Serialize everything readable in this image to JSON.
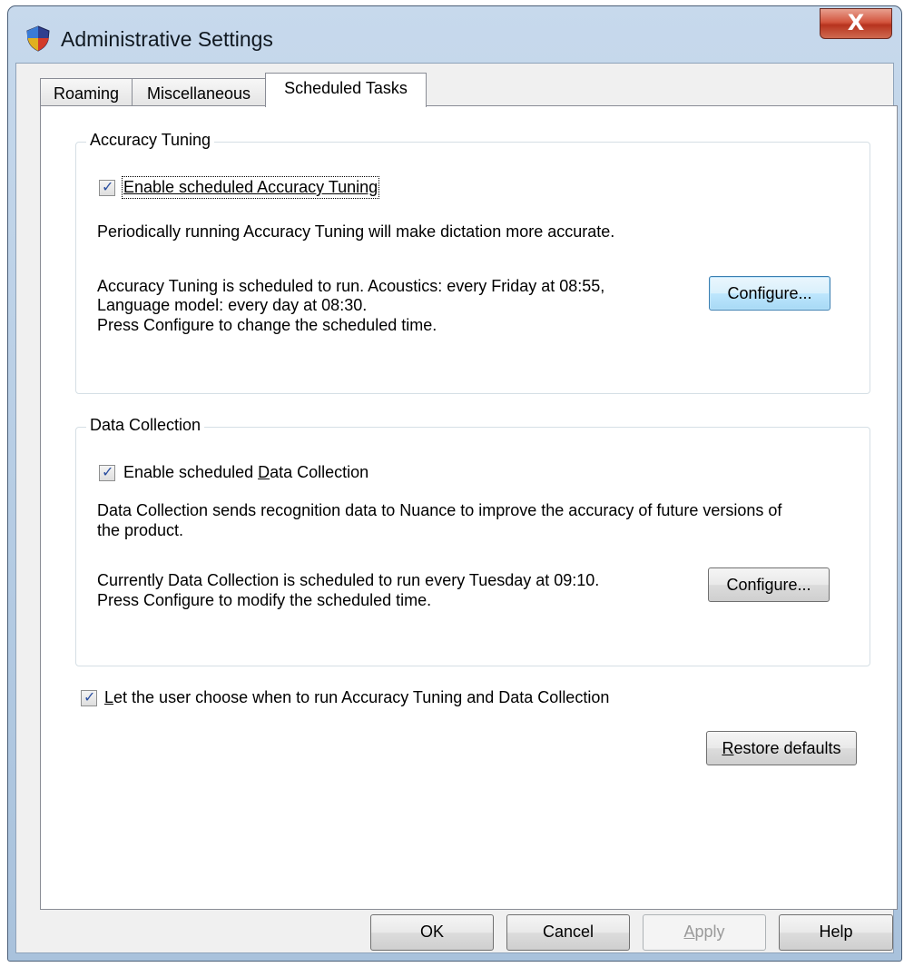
{
  "window": {
    "title": "Administrative Settings",
    "close_label": "X"
  },
  "tabs": [
    {
      "label": "Roaming"
    },
    {
      "label": "Miscellaneous"
    },
    {
      "label": "Scheduled Tasks",
      "active": true
    }
  ],
  "accuracy_tuning": {
    "group_title": "Accuracy Tuning",
    "enable_label_pre": "",
    "enable_label": "Enable scheduled Accuracy Tuning",
    "enabled": true,
    "description": "Periodically running Accuracy Tuning will make dictation more accurate.",
    "schedule_line1": "Accuracy Tuning is scheduled to run. Acoustics: every Friday at 08:55,",
    "schedule_line2": "Language model: every day at 08:30.",
    "schedule_line3": "Press Configure to change the scheduled time.",
    "configure_label": "Configure..."
  },
  "data_collection": {
    "group_title": "Data Collection",
    "enable_label_pre": "Enable scheduled ",
    "enable_label_accel": "D",
    "enable_label_post": "ata Collection",
    "enabled": true,
    "description_line1": "Data Collection sends recognition data to Nuance to improve the accuracy of future versions of",
    "description_line2": "the product.",
    "schedule_line1": "Currently Data Collection is scheduled to run every Tuesday at 09:10.",
    "schedule_line2": "Press Configure to modify the scheduled time.",
    "configure_pre": "Confi",
    "configure_accel": "g",
    "configure_post": "ure..."
  },
  "let_user_choose": {
    "accel": "L",
    "label_post": "et the user choose when to run Accuracy Tuning and Data Collection",
    "checked": true
  },
  "restore": {
    "accel": "R",
    "label_post": "estore defaults"
  },
  "footer": {
    "ok_label": "OK",
    "cancel_label": "Cancel",
    "apply_accel": "A",
    "apply_post": "pply",
    "help_label": "Help"
  }
}
